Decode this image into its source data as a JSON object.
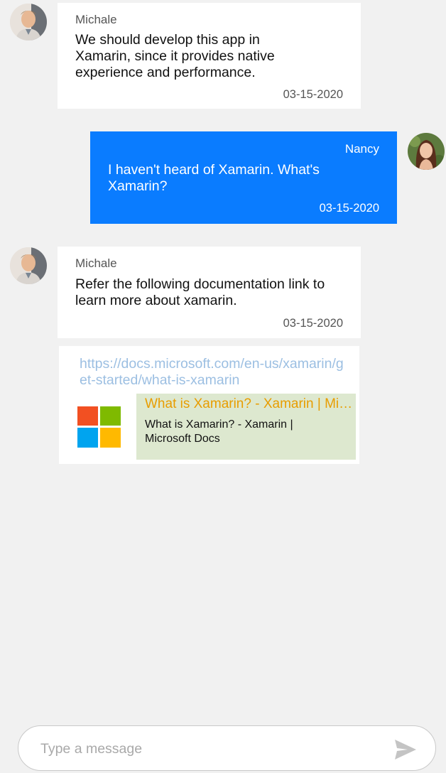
{
  "messages": [
    {
      "author": "Michale",
      "text": "We should develop this app in Xamarin, since it provides native experience and performance.",
      "time": "03-15-2020"
    },
    {
      "author": "Nancy",
      "text": "I haven't heard of Xamarin. What's Xamarin?",
      "time": "03-15-2020"
    },
    {
      "author": "Michale",
      "text": "Refer the following documentation link to learn more about xamarin.",
      "time": "03-15-2020"
    }
  ],
  "link_preview": {
    "url": "https://docs.microsoft.com/en-us/xamarin/get-started/what-is-xamarin",
    "title": "What is Xamarin? - Xamarin | Microsoft Docs",
    "description": "What is Xamarin? - Xamarin | Microsoft Docs",
    "logo_icon": "microsoft-logo"
  },
  "composer": {
    "placeholder": "Type a message",
    "send_icon": "send-icon"
  },
  "colors": {
    "background": "#f1f1f1",
    "outgoing_bubble": "#0a7cff",
    "incoming_bubble": "#ffffff",
    "link_text": "#9cbfe2",
    "preview_background": "#dde8cf",
    "preview_title": "#e89d00"
  }
}
